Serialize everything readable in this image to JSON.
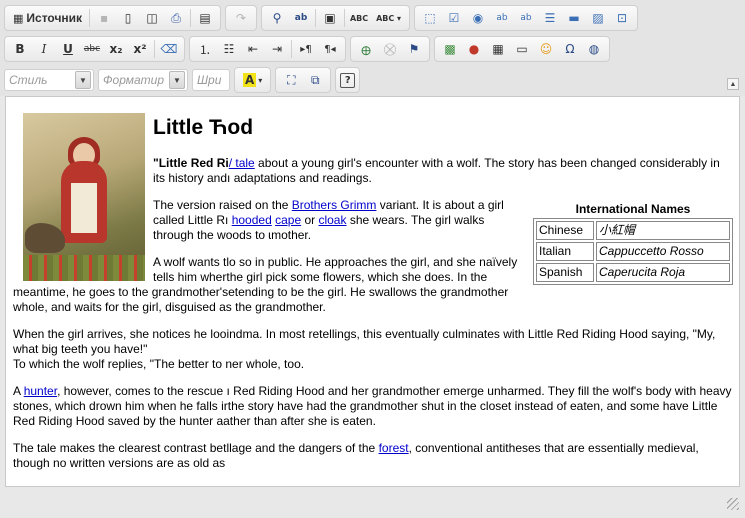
{
  "toolbar": {
    "source_label": "Источник",
    "style_combo": "Стиль",
    "format_combo": "Форматир",
    "font_combo": "Шри"
  },
  "document": {
    "heading": "Little Ћod",
    "p1": {
      "bold": "\"Little Red Ri",
      "link": "/ tale",
      "rest": " about a young girl's encounter with a wolf. The story has been changed considerably in its history andı adaptations and readings."
    },
    "p2": {
      "t1": "The version raised on the ",
      "link1": "Brothers Grimm",
      "t2": " variant. It is about a girl called Little Rı ",
      "link2": "hooded",
      "t3": " ",
      "link3": "cape",
      "t4": " or ",
      "link4": "cloak",
      "t5": " she wears. The girl walks through the woods to ɩmother."
    },
    "p3": "A wolf wants tlo so in public. He approaches the girl, and she naïvely tells him wherthe girl pick some flowers, which she does. In the meantime, he goes to the grandmother'setending to be the girl. He swallows the grandmother whole, and waits for the girl, disguised as the grandmother.",
    "p4_line1": "When the girl arrives, she notices he looindma. In most retellings, this eventually culminates with Little Red Riding Hood saying, \"My, what big teeth you have!\"",
    "p4_line2": "To which the wolf replies, \"The better to ner whole, too.",
    "p5": {
      "t1": "A ",
      "link": "hunter",
      "t2": ", however, comes to the rescue ı Red Riding Hood and her grandmother emerge unharmed. They fill the wolf's body with heavy stones, which drown him when he falls irthe story have had the grandmother shut in the closet instead of eaten, and some have Little Red Riding Hood saved by the hunter aather than after she is eaten."
    },
    "p6": {
      "t1": "The tale makes the clearest contrast betllage and the dangers of the ",
      "link": "forest",
      "t2": ", conventional antitheses that are essentially medieval, though no written versions are as old as"
    },
    "table": {
      "caption": "International Names",
      "rows": [
        {
          "lang": "Chinese",
          "name": "小紅帽"
        },
        {
          "lang": "Italian",
          "name": "Cappuccetto Rosso"
        },
        {
          "lang": "Spanish",
          "name": "Caperucita Roja"
        }
      ]
    }
  }
}
